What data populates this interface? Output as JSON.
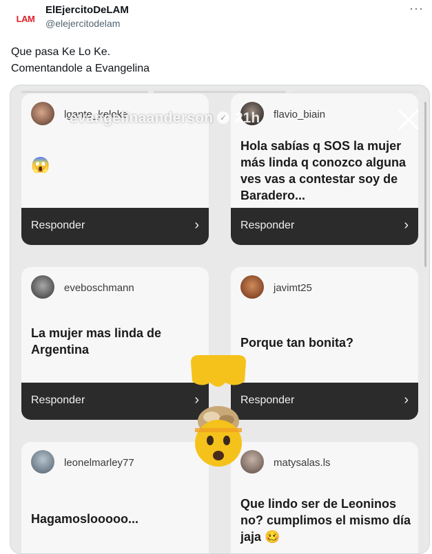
{
  "tweet": {
    "avatar_text": "LAM",
    "display_name": "ElEjercitoDeLAM",
    "handle": "@elejercitodelam",
    "more": "···",
    "text_line1": "Que pasa Ke Lo Ke.",
    "text_line2": "Comentandole a Evangelina"
  },
  "story": {
    "username": "evangelinaanderson",
    "time": "21h",
    "verified": "✓"
  },
  "cards": [
    {
      "user": "lgante_keloke",
      "text": "😱",
      "button": "Responder",
      "chevron": "›"
    },
    {
      "user": "flavio_biain",
      "text": "Hola sabías q SOS la mujer más linda q conozco alguna ves vas a contestar soy de Baradero...",
      "button": "Responder",
      "chevron": "›"
    },
    {
      "user": "eveboschmann",
      "text": "La mujer mas linda de Argentina",
      "button": "Responder",
      "chevron": "›"
    },
    {
      "user": "javimt25",
      "text": "Porque tan bonita?",
      "button": "Responder",
      "chevron": "›"
    },
    {
      "user": "leonelmarley77",
      "text": "Hagamoslooooo...",
      "button": "",
      "chevron": ""
    },
    {
      "user": "matysalas.ls",
      "text": "Que lindo ser de Leoninos no? cumplimos el mismo día jaja 🥴",
      "button": "",
      "chevron": ""
    }
  ],
  "colors": {
    "brand_red": "#e0202a",
    "button_bg": "#2b2b2b"
  }
}
